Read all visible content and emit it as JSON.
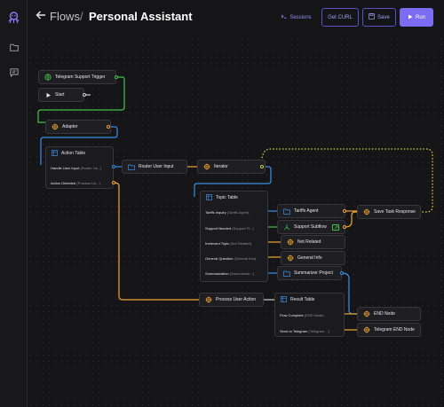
{
  "header": {
    "back_label": "Flows",
    "separator": "/",
    "title": "Personal Assistant",
    "sessions_label": "Sessions",
    "curl_label": "Get CURL",
    "save_label": "Save",
    "run_label": "Run"
  },
  "colors": {
    "accent": "#7c6cf2",
    "orange": "#f0a532",
    "blue": "#3a8ee6",
    "green": "#41c24a",
    "background": "#151517"
  },
  "sidebar": {
    "items": [
      {
        "icon": "logo-icon"
      },
      {
        "icon": "folder-icon"
      },
      {
        "icon": "chat-icon"
      }
    ]
  },
  "nodes": {
    "telegram_trigger": "Telegram Support Trigger",
    "start": "Start",
    "adapter": "Adapter",
    "router_user_input": "Router User Input",
    "iterator": "Iterator",
    "process_user_action": "Process User Action",
    "tariffs_agent": "Tariffs Agent",
    "support_subflow": "Support Subflow",
    "not_related": "Not Related",
    "general_info": "General Info",
    "summarizer_project": "Summarizer Project",
    "save_task_response": "Save Task Response",
    "end_node": "END Node",
    "telegram_end_node": "Telegram END Node"
  },
  "action_table": {
    "title": "Action Table",
    "rows": [
      {
        "label": "Handle User Input",
        "target": "(Router Us...)"
      },
      {
        "label": "Action Detected",
        "target": "(Process Us...)"
      }
    ]
  },
  "topic_table": {
    "title": "Topic Table",
    "rows": [
      {
        "label": "Tariffs Inquiry",
        "target": "(Tariffs Agent)"
      },
      {
        "label": "Support Needed",
        "target": "(Support Fl...)"
      },
      {
        "label": "Irrelevant Topic",
        "target": "(Not Related)"
      },
      {
        "label": "General Question",
        "target": "(General Info)"
      },
      {
        "label": "Summarization",
        "target": "(Summarizer...)"
      }
    ]
  },
  "result_table": {
    "title": "Result Table",
    "rows": [
      {
        "label": "Flow Complete",
        "target": "(END Node)"
      },
      {
        "label": "Send to Telegram",
        "target": "(Telegram ...)"
      }
    ]
  }
}
